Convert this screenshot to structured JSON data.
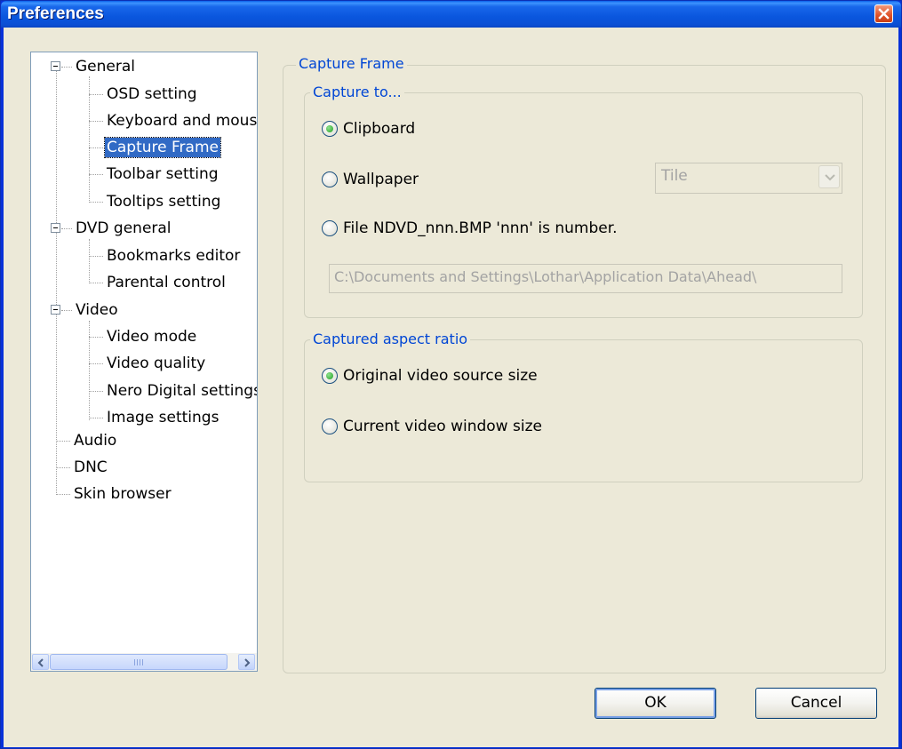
{
  "window": {
    "title": "Preferences"
  },
  "tree": {
    "items": [
      {
        "label": "General",
        "level": 0,
        "expanded": true
      },
      {
        "label": "OSD setting",
        "level": 1
      },
      {
        "label": "Keyboard and mouse",
        "level": 1
      },
      {
        "label": "Capture Frame",
        "level": 1,
        "selected": true
      },
      {
        "label": "Toolbar setting",
        "level": 1
      },
      {
        "label": "Tooltips setting",
        "level": 1
      },
      {
        "label": "DVD general",
        "level": 0,
        "expanded": true
      },
      {
        "label": "Bookmarks editor",
        "level": 1
      },
      {
        "label": "Parental control",
        "level": 1
      },
      {
        "label": "Video",
        "level": 0,
        "expanded": true
      },
      {
        "label": "Video mode",
        "level": 1
      },
      {
        "label": "Video quality",
        "level": 1
      },
      {
        "label": "Nero Digital settings",
        "level": 1
      },
      {
        "label": "Image settings",
        "level": 1
      },
      {
        "label": "Audio",
        "level": 0
      },
      {
        "label": "DNC",
        "level": 0
      },
      {
        "label": "Skin browser",
        "level": 0
      }
    ]
  },
  "capture_frame": {
    "legend": "Capture Frame",
    "capture_to": {
      "legend": "Capture to...",
      "clipboard_label": "Clipboard",
      "wallpaper_label": "Wallpaper",
      "file_label": "File NDVD_nnn.BMP 'nnn' is number.",
      "selected": "clipboard",
      "wallpaper_mode": "Tile",
      "path": "C:\\Documents and Settings\\Lothar\\Application Data\\Ahead\\"
    },
    "aspect_ratio": {
      "legend": "Captured aspect ratio",
      "original_label": "Original video source size",
      "current_label": "Current video window size",
      "selected": "original"
    }
  },
  "buttons": {
    "ok": "OK",
    "cancel": "Cancel"
  },
  "colors": {
    "title_bar": "#0a56de",
    "legend_text": "#0046d5",
    "selection": "#316ac5"
  },
  "icons": {
    "close": "close-icon",
    "scroll_left": "arrow-left-icon",
    "scroll_right": "arrow-right-icon",
    "combo": "chevron-down-icon"
  }
}
